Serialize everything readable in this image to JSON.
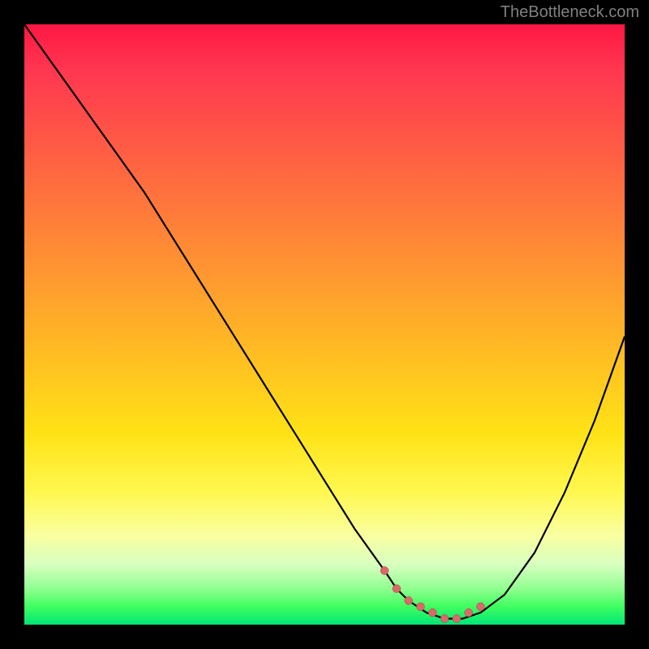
{
  "watermark": "TheBottleneck.com",
  "chart_data": {
    "type": "line",
    "title": "",
    "xlabel": "",
    "ylabel": "",
    "xlim": [
      0,
      100
    ],
    "ylim": [
      0,
      100
    ],
    "grid": false,
    "legend": false,
    "series": [
      {
        "name": "curve",
        "x": [
          0,
          5,
          10,
          15,
          20,
          25,
          30,
          35,
          40,
          45,
          50,
          55,
          60,
          62,
          64,
          67,
          70,
          73,
          76,
          80,
          85,
          90,
          95,
          100
        ],
        "y": [
          100,
          93,
          86,
          79,
          72,
          64,
          56,
          48,
          40,
          32,
          24,
          16,
          9,
          6,
          4,
          2,
          1,
          1,
          2,
          5,
          12,
          22,
          34,
          48
        ]
      }
    ],
    "markers": {
      "name": "highlighted-points",
      "color": "#d96a6a",
      "x": [
        60,
        62,
        64,
        66,
        68,
        70,
        72,
        74,
        76
      ],
      "y": [
        9,
        6,
        4,
        3,
        2,
        1,
        1,
        2,
        3
      ]
    },
    "background_gradient": {
      "top": "#ff1744",
      "middle": "#ffe216",
      "bottom": "#00e676"
    }
  }
}
